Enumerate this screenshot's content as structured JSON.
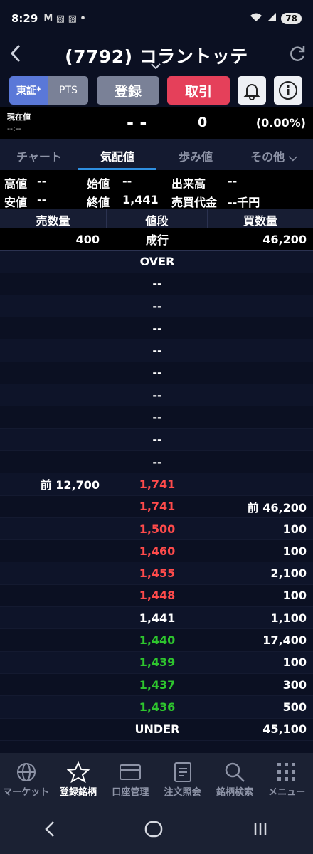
{
  "status_bar": {
    "time": "8:29",
    "notif_icons": "M ▨ ▧ •",
    "battery": "78"
  },
  "header": {
    "title": "(7792) コラントッテ"
  },
  "actions": {
    "market_primary": "東証*",
    "market_pts": "PTS",
    "register": "登録",
    "trade": "取引"
  },
  "price": {
    "label": "現在値",
    "time": "--:--",
    "current": "- -",
    "change": "0",
    "change_pct": "(0.00%)"
  },
  "tabs": [
    {
      "label": "チャート"
    },
    {
      "label": "気配値"
    },
    {
      "label": "歩み値"
    },
    {
      "label": "その他 ⌵"
    }
  ],
  "stats": {
    "high_label": "高値",
    "high": "--",
    "open_label": "始値",
    "open": "--",
    "volume_label": "出来高",
    "volume": "--",
    "low_label": "安値",
    "low": "--",
    "close_label": "終値",
    "close": "1,441",
    "turnover_label": "売買代金",
    "turnover": "--千円"
  },
  "book_header": {
    "sell": "売数量",
    "price": "値段",
    "buy": "買数量"
  },
  "book_rows": [
    {
      "sell": "400",
      "price": "成行",
      "buy": "46,200",
      "price_color": "#ffffff"
    },
    {
      "sell": "",
      "price": "OVER",
      "buy": "",
      "price_color": "#ffffff"
    },
    {
      "sell": "",
      "price": "--",
      "buy": "",
      "price_color": "#ffffff"
    },
    {
      "sell": "",
      "price": "--",
      "buy": "",
      "price_color": "#ffffff"
    },
    {
      "sell": "",
      "price": "--",
      "buy": "",
      "price_color": "#ffffff"
    },
    {
      "sell": "",
      "price": "--",
      "buy": "",
      "price_color": "#ffffff"
    },
    {
      "sell": "",
      "price": "--",
      "buy": "",
      "price_color": "#ffffff"
    },
    {
      "sell": "",
      "price": "--",
      "buy": "",
      "price_color": "#ffffff"
    },
    {
      "sell": "",
      "price": "--",
      "buy": "",
      "price_color": "#ffffff"
    },
    {
      "sell": "",
      "price": "--",
      "buy": "",
      "price_color": "#ffffff"
    },
    {
      "sell": "",
      "price": "--",
      "buy": "",
      "price_color": "#ffffff"
    },
    {
      "sell": "前 12,700",
      "price": "1,741",
      "buy": "",
      "price_color": "#ff4b4b"
    },
    {
      "sell": "",
      "price": "1,741",
      "buy": "前 46,200",
      "price_color": "#ff4b4b"
    },
    {
      "sell": "",
      "price": "1,500",
      "buy": "100",
      "price_color": "#ff4b4b"
    },
    {
      "sell": "",
      "price": "1,460",
      "buy": "100",
      "price_color": "#ff4b4b"
    },
    {
      "sell": "",
      "price": "1,455",
      "buy": "2,100",
      "price_color": "#ff4b4b"
    },
    {
      "sell": "",
      "price": "1,448",
      "buy": "100",
      "price_color": "#ff4b4b"
    },
    {
      "sell": "",
      "price": "1,441",
      "buy": "1,100",
      "price_color": "#ffffff"
    },
    {
      "sell": "",
      "price": "1,440",
      "buy": "17,400",
      "price_color": "#2ec52e"
    },
    {
      "sell": "",
      "price": "1,439",
      "buy": "100",
      "price_color": "#2ec52e"
    },
    {
      "sell": "",
      "price": "1,437",
      "buy": "300",
      "price_color": "#2ec52e"
    },
    {
      "sell": "",
      "price": "1,436",
      "buy": "500",
      "price_color": "#2ec52e"
    },
    {
      "sell": "",
      "price": "UNDER",
      "buy": "45,100",
      "price_color": "#ffffff"
    }
  ],
  "bottom_nav": [
    {
      "label": "マーケット",
      "icon": "globe-icon"
    },
    {
      "label": "登録銘柄",
      "icon": "star-icon"
    },
    {
      "label": "口座管理",
      "icon": "card-icon"
    },
    {
      "label": "注文照会",
      "icon": "document-icon"
    },
    {
      "label": "銘柄検索",
      "icon": "search-icon"
    },
    {
      "label": "メニュー",
      "icon": "grid-icon"
    }
  ],
  "colors": {
    "up": "#ff4b4b",
    "down": "#2ec52e",
    "accent": "#2f8fe0",
    "trade": "#e5405a"
  }
}
